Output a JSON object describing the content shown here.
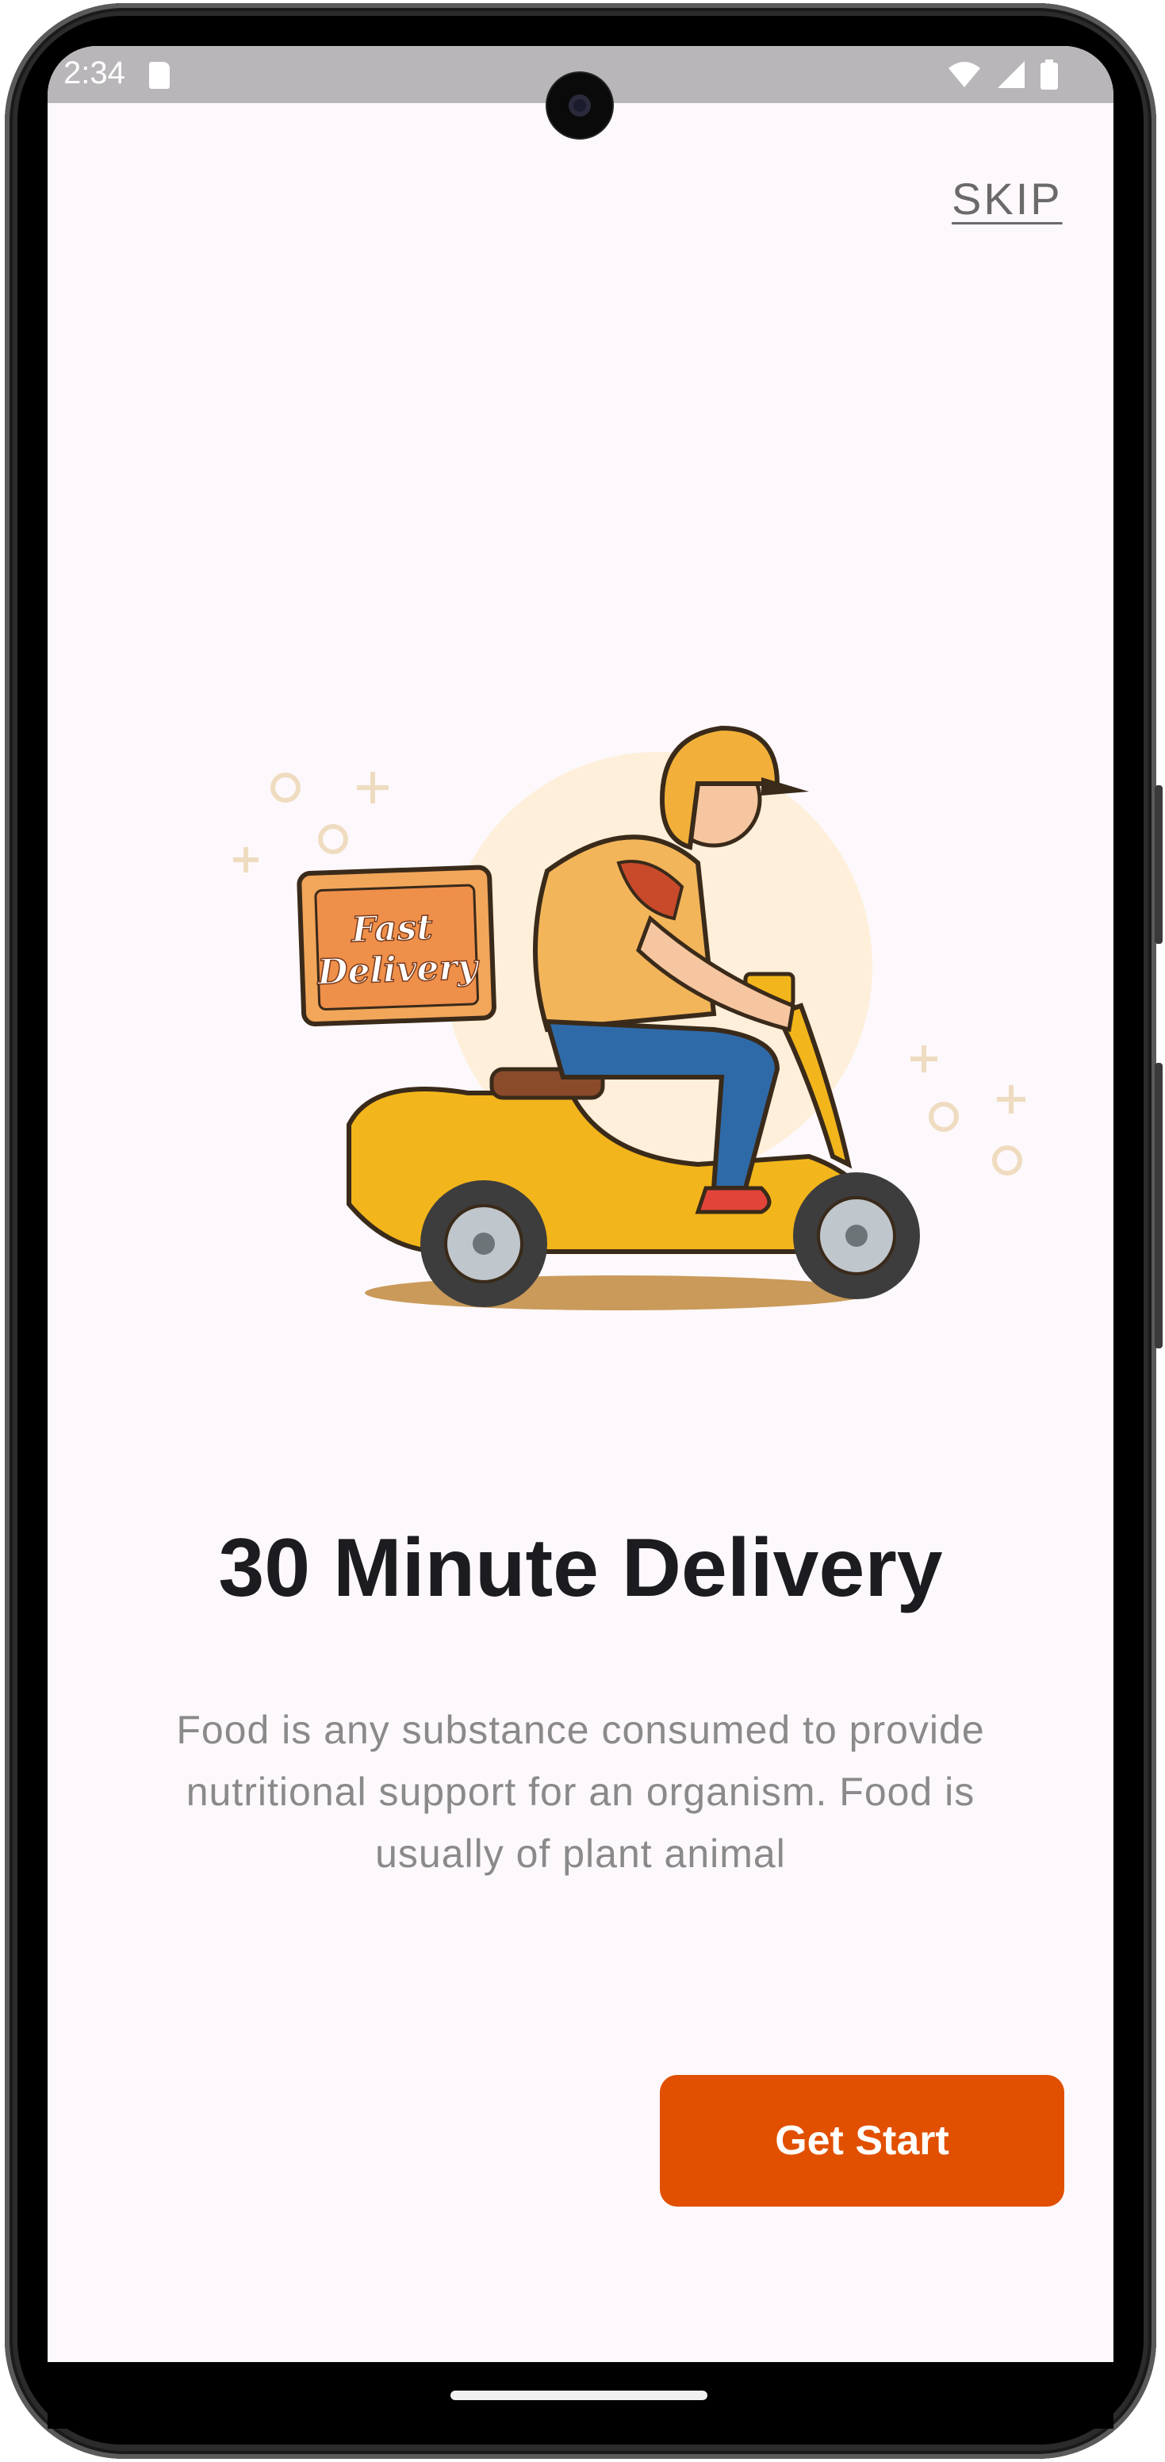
{
  "status_bar": {
    "time": "2:34",
    "icons": [
      "sd-card-icon",
      "wifi-icon",
      "signal-icon",
      "battery-icon"
    ]
  },
  "onboarding": {
    "skip_label": "SKIP",
    "illustration": {
      "box_text_line1": "Fast",
      "box_text_line2": "Delivery"
    },
    "title": "30 Minute Delivery",
    "description": "Food is any substance consumed to provide nutritional support for an organism. Food is usually of plant animal",
    "cta_label": "Get Start"
  },
  "colors": {
    "background": "#fdf8fb",
    "accent": "#e15000",
    "title": "#1c1b1f",
    "body_text": "#8a8a8a"
  }
}
